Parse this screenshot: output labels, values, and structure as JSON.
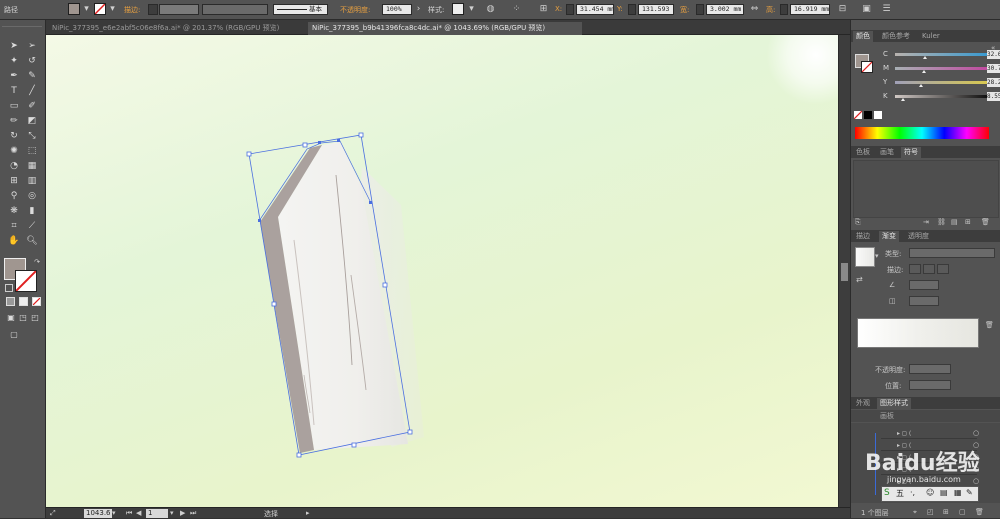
{
  "control_bar": {
    "object_type": "路径",
    "stroke_label": "描边:",
    "stroke_profile": "基本",
    "opacity_label": "不透明度:",
    "opacity_value": "100%",
    "style_label": "样式:",
    "x_label": "X:",
    "x_value": "31.454 mm",
    "y_label": "Y:",
    "y_value": "131.593",
    "w_label": "宽:",
    "w_value": "3.002 mm",
    "h_label": "高:",
    "h_value": "16.919 mm",
    "fill_color": "#a09690"
  },
  "tabs": [
    {
      "label": "NiPic_377395_e6e2abf5c06e8f6a.ai* @ 201.37% (RGB/GPU 预览)",
      "active": false
    },
    {
      "label": "NiPic_377395_b9b41396fca8c4dc.ai* @ 1043.69% (RGB/GPU 预览)",
      "active": true
    }
  ],
  "status": {
    "zoom": "1043.6",
    "page": "1",
    "tool": "选择"
  },
  "color_panel": {
    "tabs": [
      "颜色",
      "颜色参考",
      "Kuler"
    ],
    "channels": [
      {
        "name": "C",
        "value": "32.66",
        "fraction": 0.33,
        "grad": "linear-gradient(90deg,#b8b2ae,#3a9ad0)"
      },
      {
        "name": "M",
        "value": "30.72",
        "fraction": 0.31,
        "grad": "linear-gradient(90deg,#a8b0b4,#c04aa0)"
      },
      {
        "name": "Y",
        "value": "28.2",
        "fraction": 0.28,
        "grad": "linear-gradient(90deg,#a0a0b8,#d8c850)"
      },
      {
        "name": "K",
        "value": "8.55",
        "fraction": 0.09,
        "grad": "linear-gradient(90deg,#d0c8c4,#101010)"
      }
    ]
  },
  "swatch_panel": {
    "tabs": [
      "色板",
      "画笔",
      "符号"
    ]
  },
  "gradient_panel": {
    "tabs": [
      "描边",
      "渐变",
      "透明度"
    ],
    "type_label": "类型:",
    "stroke_label": "描边:",
    "opacity_label": "不透明度:",
    "position_label": "位置:"
  },
  "appearance_panel": {
    "tabs": [
      "外观",
      "图形样式"
    ],
    "sub_tab": "画板",
    "layer_label": "1 个图层"
  },
  "watermark": {
    "text": "Baidu经验",
    "url": "jingyan.baidu.com"
  }
}
